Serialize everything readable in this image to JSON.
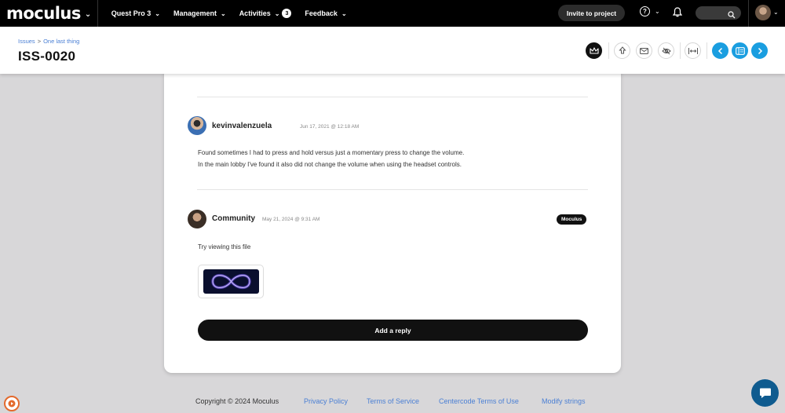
{
  "nav": {
    "logo": "moculus",
    "items": [
      {
        "label": "Quest Pro 3"
      },
      {
        "label": "Management"
      },
      {
        "label": "Activities",
        "badge": "3"
      },
      {
        "label": "Feedback"
      }
    ],
    "invite_label": "Invite to project",
    "help_symbol": "?"
  },
  "header": {
    "breadcrumb": [
      "Issues",
      "One last thing"
    ],
    "breadcrumb_sep": ">",
    "title": "ISS-0020"
  },
  "comments": [
    {
      "author": "kevinvalenzuela",
      "date": "Jun 17, 2021 @ 12:18 AM",
      "lines": [
        "Found sometimes I had to press and hold versus just a momentary press to change the volume.",
        "In the main lobby I've found it also did not change the volume when using the headset controls."
      ]
    },
    {
      "author": "Community",
      "date": "May 21, 2024 @ 9:31 AM",
      "tag": "Moculus",
      "lines": [
        "Try viewing this file"
      ]
    }
  ],
  "reply_label": "Add a reply",
  "footer": {
    "copyright": "Copyright © 2024 Moculus",
    "links": [
      "Privacy Policy",
      "Terms of Service",
      "Centercode Terms of Use",
      "Modify strings"
    ]
  },
  "colors": {
    "accent_blue": "#1a9ee0",
    "link_blue": "#4a7fd4",
    "nav_bg": "#000000",
    "page_bg": "#d8d7d9"
  },
  "icons": [
    "chevron-down-icon",
    "help-icon",
    "bell-icon",
    "search-icon",
    "crown-icon",
    "upload-icon",
    "mail-icon",
    "hide-icon",
    "expand-width-icon",
    "chevron-left-icon",
    "sidebar-icon",
    "chevron-right-icon",
    "chat-icon"
  ]
}
